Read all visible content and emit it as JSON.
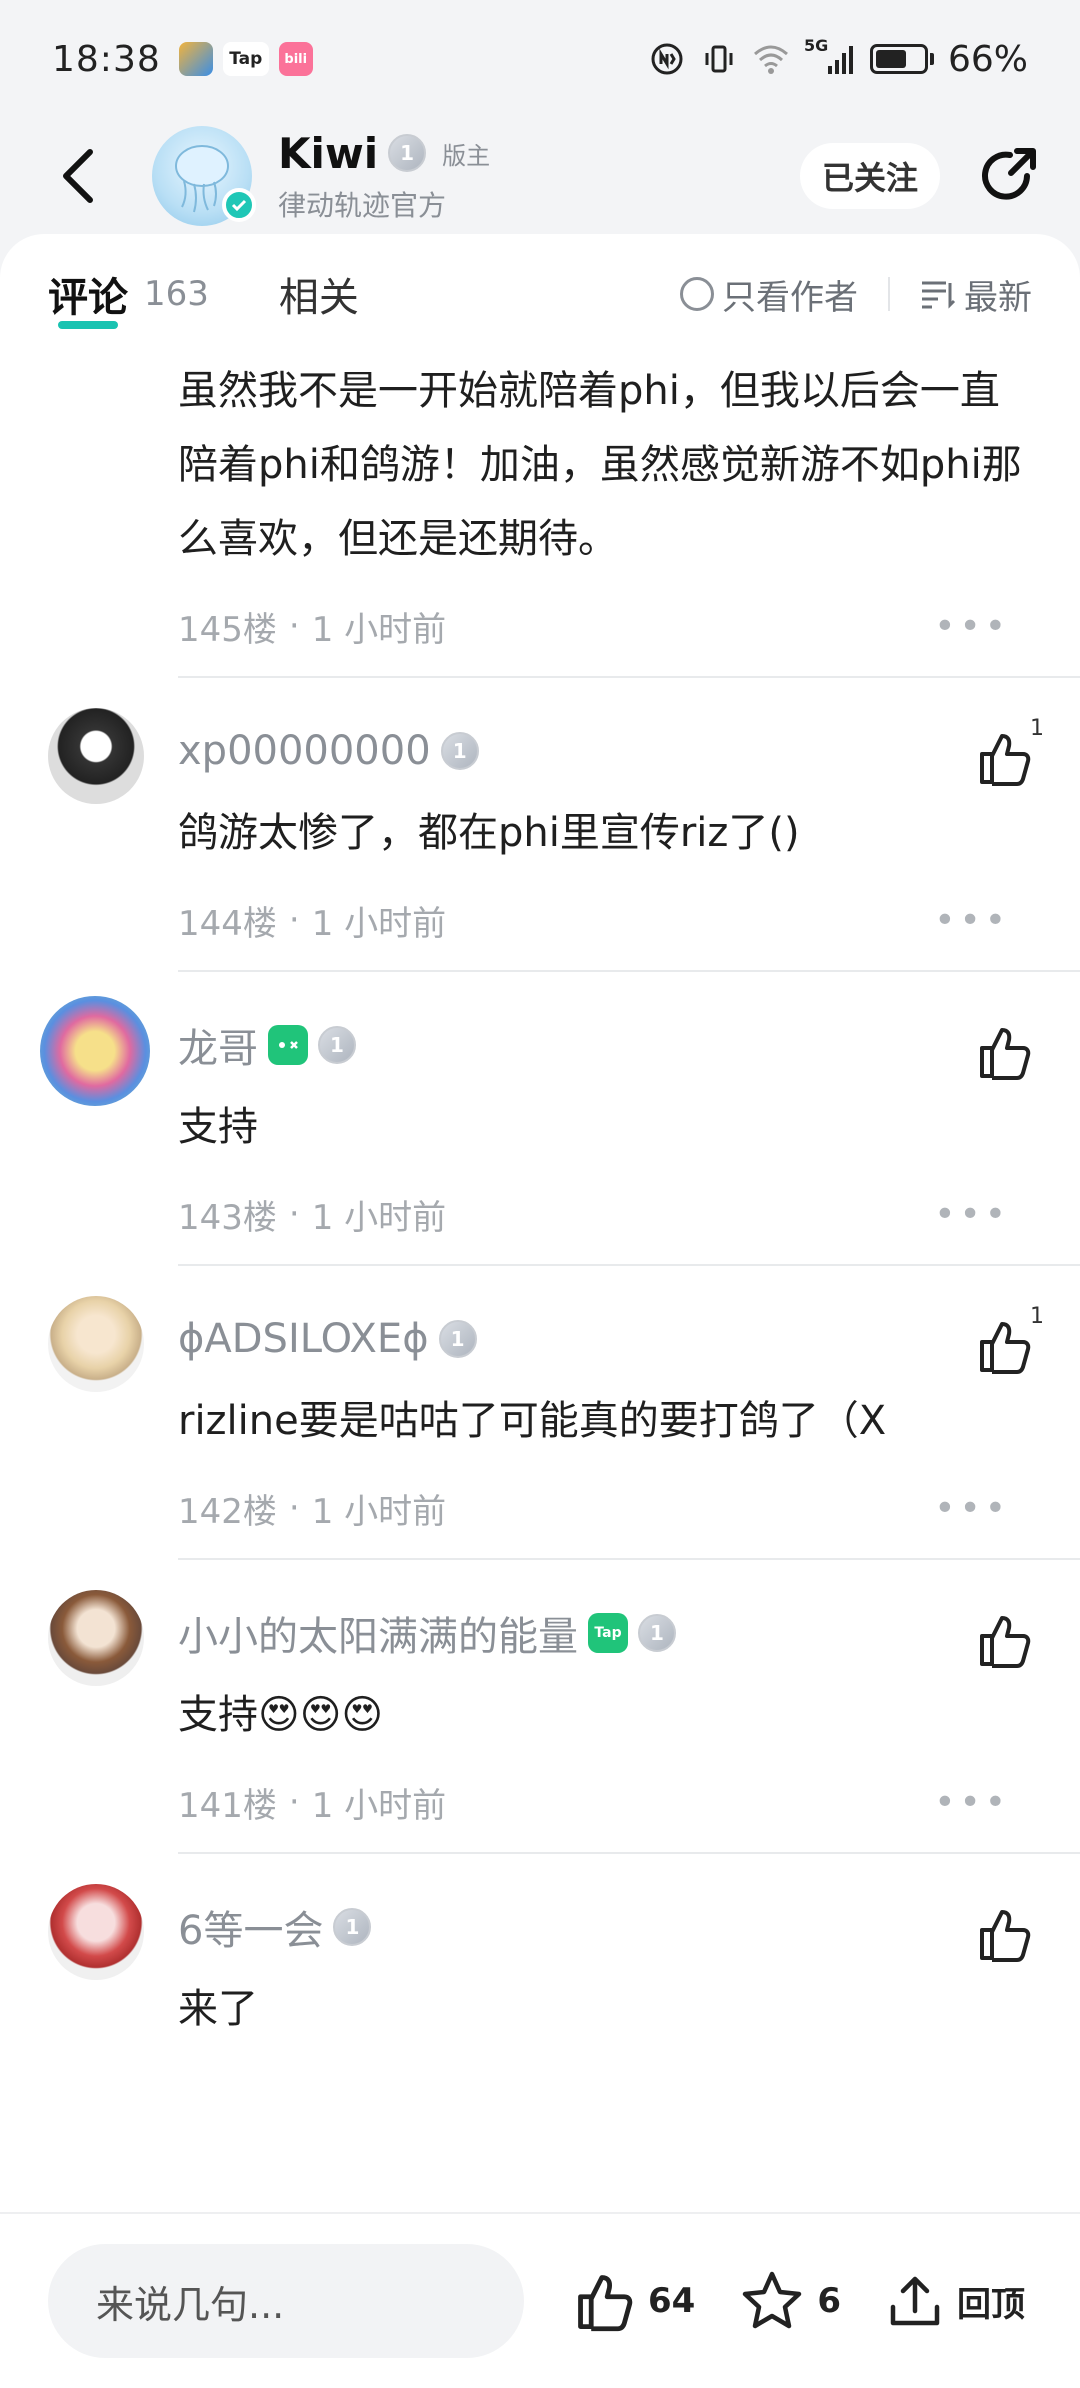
{
  "status_bar": {
    "time": "18:38",
    "battery": "66%",
    "network": "5G",
    "apps": [
      {
        "name": "weather",
        "color": "#f2b33d",
        "label": ""
      },
      {
        "name": "Tap",
        "color": "#ffffff",
        "label": "Tap"
      },
      {
        "name": "bilibili",
        "color": "#fb7299",
        "label": "bili"
      }
    ]
  },
  "header": {
    "name": "Kiwi",
    "level": "1",
    "role": "版主",
    "subtitle": "律动轨迹官方",
    "follow_label": "已关注"
  },
  "tabs": {
    "comments_label": "评论",
    "comments_count": "163",
    "related_label": "相关",
    "author_only_label": "只看作者",
    "sort_label": "最新"
  },
  "comments": [
    {
      "text": "虽然我不是一开始就陪着phi，但我以后会一直陪着phi和鸽游！加油，虽然感觉新游不如phi那么喜欢，但还是还期待。",
      "floor": "145楼",
      "time": "1 小时前"
    },
    {
      "user": "xp00000000",
      "text": "鸽游太惨了，都在phi里宣传riz了()",
      "floor": "144楼",
      "time": "1 小时前",
      "likes": "1"
    },
    {
      "user": "龙哥",
      "text": "支持",
      "floor": "143楼",
      "time": "1 小时前",
      "likes": ""
    },
    {
      "user": "ϕADSILOXEϕ",
      "text": "rizline要是咕咕了可能真的要打鸽了（X",
      "floor": "142楼",
      "time": "1 小时前",
      "likes": "1"
    },
    {
      "user": "小小的太阳满满的能量",
      "text": "支持😍😍😍",
      "floor": "141楼",
      "time": "1 小时前",
      "likes": ""
    },
    {
      "user": "6等一会",
      "text": "来了",
      "likes": ""
    }
  ],
  "bottom_bar": {
    "input_placeholder": "来说几句...",
    "like_count": "64",
    "star_count": "6",
    "top_label": "回顶"
  },
  "colors": {
    "accent": "#19c3b1",
    "tap_badge": "#20c47a"
  }
}
